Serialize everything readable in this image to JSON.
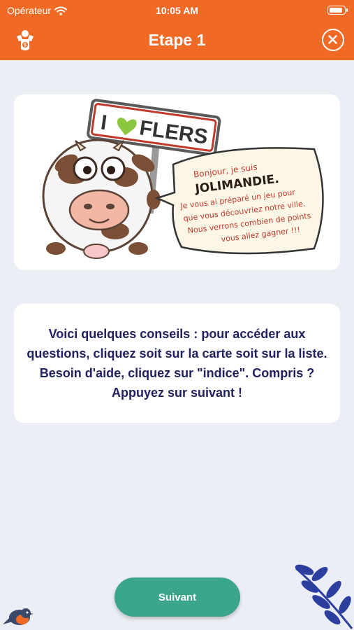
{
  "status_bar": {
    "carrier": "Opérateur",
    "time": "10:05 AM"
  },
  "nav": {
    "title": "Etape 1"
  },
  "illustration": {
    "sign_text": "FLERS",
    "sign_letter": "I",
    "bubble": {
      "line1": "Bonjour, je suis",
      "name": "JOLIMANDIE.",
      "line2": "Je vous ai préparé un jeu pour",
      "line3": "que vous découvriez notre ville.",
      "line4": "Nous verrons combien de points",
      "line5": "vous allez gagner !!!"
    }
  },
  "tips": {
    "text": "Voici quelques conseils : pour accéder aux questions, cliquez soit sur la carte soit sur la liste. Besoin d'aide, cliquez sur \"indice\". Compris ? Appuyez sur suivant !"
  },
  "next_button": {
    "label": "Suivant"
  },
  "colors": {
    "header": "#f06a26",
    "button": "#3aa58a",
    "text": "#1f2160",
    "background": "#ebeef4"
  }
}
